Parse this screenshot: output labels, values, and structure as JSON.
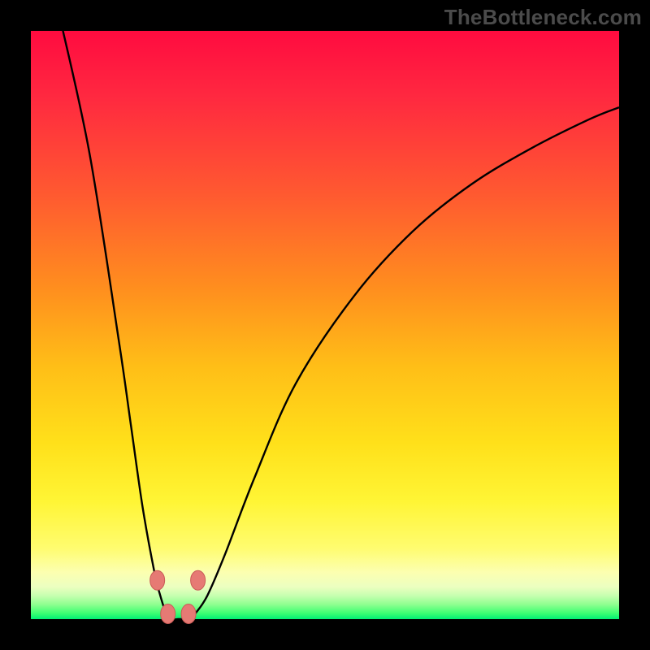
{
  "watermark": "TheBottleneck.com",
  "colors": {
    "frame": "#000000",
    "curve_stroke": "#000000",
    "marker_fill": "#e67a74",
    "marker_stroke": "#ca5a56",
    "gradient_top": "#ff0b3f",
    "gradient_bottom": "#00ef74"
  },
  "chart_data": {
    "type": "line",
    "title": "",
    "xlabel": "",
    "ylabel": "",
    "xlim": [
      0,
      100
    ],
    "ylim": [
      0,
      100
    ],
    "x": [
      5,
      10,
      15,
      17,
      19,
      21,
      22,
      23,
      24,
      25,
      26,
      27,
      28,
      30,
      33,
      38,
      45,
      55,
      65,
      75,
      85,
      95,
      100
    ],
    "values": [
      102,
      79,
      47,
      33,
      19,
      8,
      4,
      1,
      0,
      0,
      0,
      0,
      1,
      4,
      11,
      24,
      40,
      55,
      66,
      74,
      80,
      85,
      87
    ],
    "markers": {
      "x": [
        21.5,
        23.3,
        26.8,
        28.4
      ],
      "y": [
        6.6,
        0.9,
        0.9,
        6.6
      ]
    }
  }
}
